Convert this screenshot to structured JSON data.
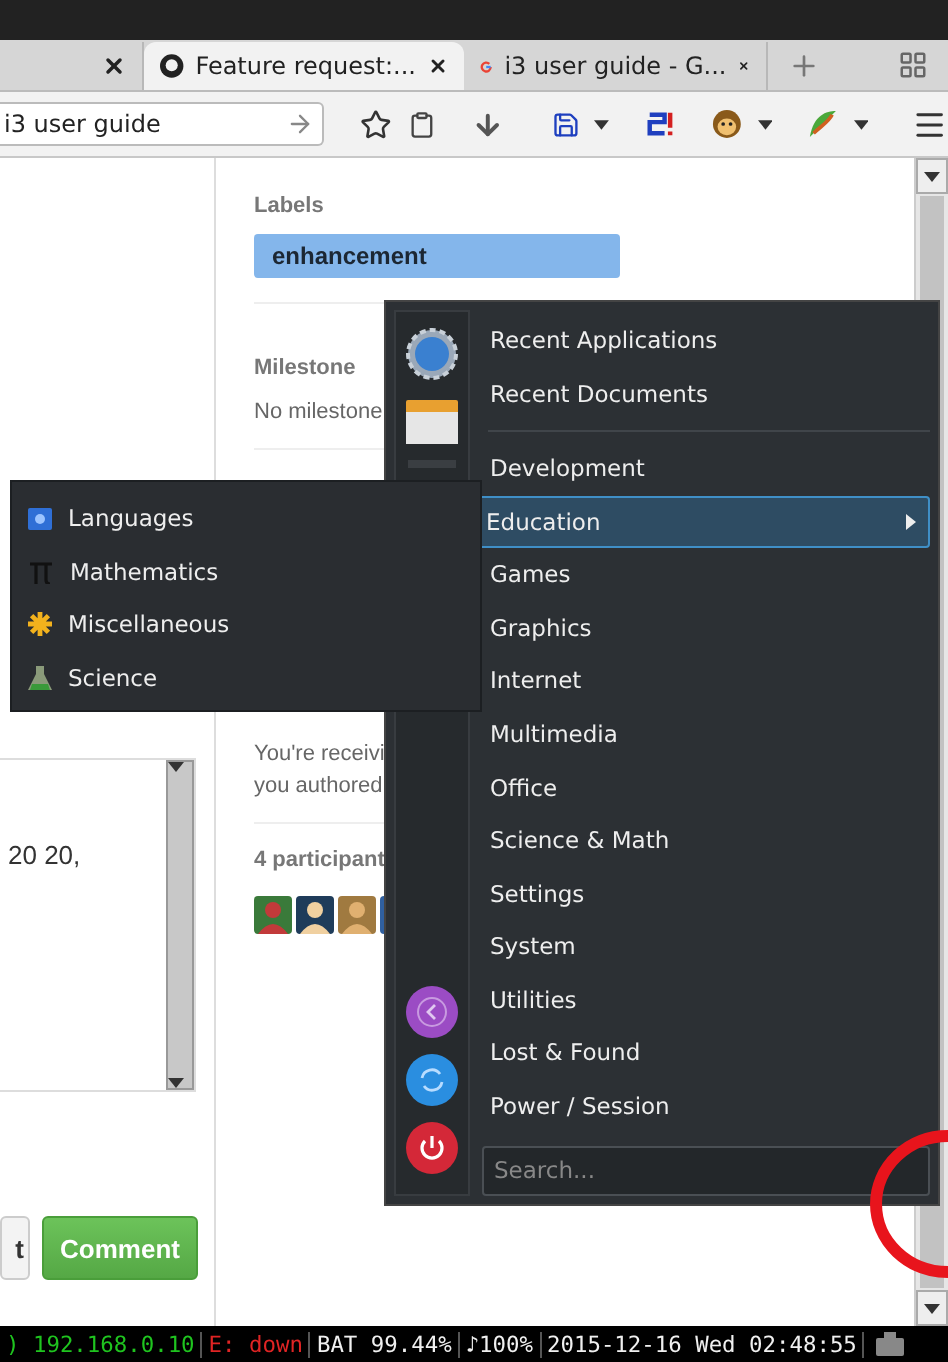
{
  "browser": {
    "tabs": [
      {
        "selected": false
      },
      {
        "title": "Feature request:...",
        "selected": true
      },
      {
        "title": "i3 user guide - G...",
        "selected": false
      }
    ],
    "address_bar": {
      "value": "i3 user guide"
    }
  },
  "page": {
    "labels_heading": "Labels",
    "labels": [
      "enhancement"
    ],
    "milestone_heading": "Milestone",
    "milestone": "No milestone",
    "notice_lines": [
      "You're receivi",
      "you authored"
    ],
    "participants_heading": "4 participant",
    "participants": [
      {
        "kind": "picture"
      },
      {
        "kind": "picture"
      },
      {
        "kind": "picture"
      },
      {
        "kind": "picture"
      }
    ],
    "comment_box": {
      "value": "20 20,"
    },
    "buttons": [
      {
        "label": "t",
        "kind": "secondary"
      },
      {
        "label": "Comment",
        "kind": "primary"
      }
    ]
  },
  "app_menu": {
    "items": [
      {
        "label": "Recent Applications",
        "selected": false
      },
      {
        "label": "Recent Documents",
        "selected": false
      },
      {
        "kind": "separator"
      },
      {
        "label": "Development",
        "selected": false
      },
      {
        "label": "Education",
        "selected": true,
        "has_submenu": true
      },
      {
        "label": "Games",
        "selected": false
      },
      {
        "label": "Graphics",
        "selected": false
      },
      {
        "label": "Internet",
        "selected": false
      },
      {
        "label": "Multimedia",
        "selected": false
      },
      {
        "label": "Office",
        "selected": false
      },
      {
        "label": "Science & Math",
        "selected": false
      },
      {
        "label": "Settings",
        "selected": false
      },
      {
        "label": "System",
        "selected": false
      },
      {
        "label": "Utilities",
        "selected": false
      },
      {
        "label": "Lost & Found",
        "selected": false
      },
      {
        "label": "Power / Session",
        "selected": false
      }
    ],
    "search": {
      "placeholder": "Search..."
    }
  },
  "submenu": {
    "items": [
      {
        "label": "Languages"
      },
      {
        "label": "Mathematics"
      },
      {
        "label": "Miscellaneous"
      },
      {
        "label": "Science"
      }
    ]
  },
  "status_bar": {
    "segments": [
      {
        "text": ") 192.168.0.10",
        "color": "#1fc41f"
      },
      {
        "text": "E: down",
        "color": "#e02424"
      },
      {
        "text": "BAT 99.44%",
        "color": "#f0f0f0"
      },
      {
        "text": "♪100%",
        "color": "#f0f0f0"
      },
      {
        "text": "2015-12-16 Wed 02:48:55",
        "color": "#f0f0f0"
      }
    ]
  }
}
